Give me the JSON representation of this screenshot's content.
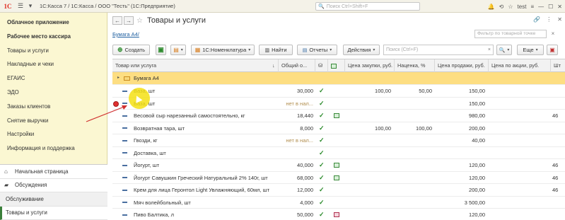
{
  "app": {
    "logo_text": "1С",
    "title": "1С:Касса 7 / 1С:Касса / ООО \"Тесть\"  (1С:Предприятие)",
    "search_placeholder": "Поиск Ctrl+Shift+F",
    "user": "test"
  },
  "sidebar": {
    "items": [
      {
        "label": "Облачное приложение",
        "bold": true
      },
      {
        "label": "Рабочее место кассира",
        "bold": true
      },
      {
        "label": "Товары и услуги",
        "bold": false
      },
      {
        "label": "Накладные и чеки",
        "bold": false
      },
      {
        "label": "ЕГАИС",
        "bold": false
      },
      {
        "label": "ЭДО",
        "bold": false
      },
      {
        "label": "Заказы клиентов",
        "bold": false
      },
      {
        "label": "Снятие выручки",
        "bold": false
      },
      {
        "label": "Настройки",
        "bold": false
      },
      {
        "label": "Информация и поддержка",
        "bold": false
      }
    ],
    "bottom": {
      "home": "Начальная страница",
      "discussions": "Обсуждения",
      "section": "Обслуживание",
      "active": "Товары и услуги"
    }
  },
  "main": {
    "title": "Товары и услуги",
    "breadcrumb": "Бумага А4/",
    "filter_placeholder": "Фильтр по товарной точке"
  },
  "toolbar": {
    "create": "Создать",
    "nomenclature": "1С:Номенклатура",
    "find": "Найти",
    "reports": "Отчеты",
    "actions": "Действия",
    "search_placeholder": "Поиск (Ctrl+F)",
    "more": "Еще"
  },
  "table": {
    "headers": {
      "name": "Товар или услуга",
      "stock": "Общий о...",
      "purchase": "Цена закупки, руб.",
      "markup": "Наценка, %",
      "sale": "Цена продажи, руб.",
      "promo": "Цена по акции, руб.",
      "extra": "Шт"
    },
    "group": "Бумага А4",
    "rows": [
      {
        "name": "Ваза, шт",
        "stock": "30,000",
        "check": true,
        "cal": "",
        "purchase": "100,00",
        "markup": "50,00",
        "sale": "150,00",
        "extra": ""
      },
      {
        "name": "Ваза, шт",
        "stock": "нет в нал...",
        "check": true,
        "cal": "",
        "purchase": "",
        "markup": "",
        "sale": "150,00",
        "extra": ""
      },
      {
        "name": "Весовой сыр нарезанный самостоятельно, кг",
        "stock": "18,440",
        "check": true,
        "cal": "green",
        "purchase": "",
        "markup": "",
        "sale": "980,00",
        "extra": "46"
      },
      {
        "name": "Возвратная тара, шт",
        "stock": "8,000",
        "check": true,
        "cal": "",
        "purchase": "100,00",
        "markup": "100,00",
        "sale": "200,00",
        "extra": ""
      },
      {
        "name": "Гвозди, кг",
        "stock": "нет в нал...",
        "check": true,
        "cal": "",
        "purchase": "",
        "markup": "",
        "sale": "40,00",
        "extra": ""
      },
      {
        "name": "Доставка, шт",
        "stock": "",
        "check": true,
        "cal": "",
        "purchase": "",
        "markup": "",
        "sale": "",
        "extra": ""
      },
      {
        "name": "Йогурт, шт",
        "stock": "40,000",
        "check": true,
        "cal": "green",
        "purchase": "",
        "markup": "",
        "sale": "120,00",
        "extra": "46"
      },
      {
        "name": "Йогурт Савушкин Греческий Натуральный 2% 140г, шт",
        "stock": "68,000",
        "check": true,
        "cal": "green",
        "purchase": "",
        "markup": "",
        "sale": "120,00",
        "extra": "46"
      },
      {
        "name": "Крем для лица Геронтол Light Увлажняющий, 60мл, шт",
        "stock": "12,000",
        "check": true,
        "cal": "",
        "purchase": "",
        "markup": "",
        "sale": "200,00",
        "extra": "46"
      },
      {
        "name": "Мяч волейбольный, шт",
        "stock": "4,000",
        "check": true,
        "cal": "",
        "purchase": "",
        "markup": "",
        "sale": "3 500,00",
        "extra": ""
      },
      {
        "name": "Пиво Балтика, л",
        "stock": "50,000",
        "check": true,
        "cal": "red",
        "purchase": "",
        "markup": "",
        "sale": "120,00",
        "extra": ""
      }
    ]
  },
  "colors": {
    "sidebar_bg": "#fbf7d2",
    "group_row": "#fdde82",
    "check": "#2a8a2a",
    "highlight": "#f5e114",
    "arrow": "#d03030"
  }
}
